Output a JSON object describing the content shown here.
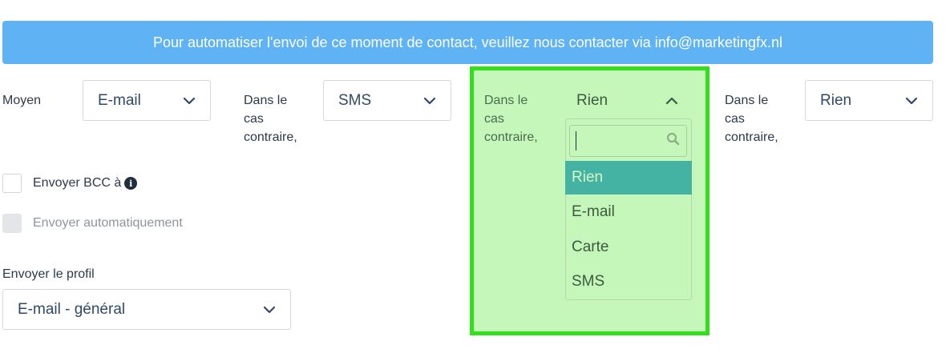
{
  "banner": {
    "text": "Pour automatiser l'envoi de ce moment de contact, veuillez nous contacter via info@marketingfx.nl"
  },
  "moyen": {
    "label": "Moyen",
    "value": "E-mail"
  },
  "fallback1": {
    "label_lines": [
      "Dans le",
      "cas",
      "contraire,"
    ],
    "value": "SMS"
  },
  "fallback2": {
    "label_lines": [
      "Dans le",
      "cas",
      "contraire,"
    ],
    "value": "Rien",
    "search_placeholder": "",
    "options": [
      "Rien",
      "E-mail",
      "Carte",
      "SMS"
    ],
    "selected_index": 0
  },
  "fallback3": {
    "label_lines": [
      "Dans le",
      "cas",
      "contraire,"
    ],
    "value": "Rien"
  },
  "bcc": {
    "label": "Envoyer BCC à",
    "checked": false
  },
  "auto_send": {
    "label": "Envoyer automatiquement",
    "checked": false,
    "disabled": true
  },
  "profile": {
    "label": "Envoyer le profil",
    "value": "E-mail - général"
  },
  "colors": {
    "banner": "#5fb3f4",
    "highlight_fill": "#c6f7ba",
    "highlight_border": "#2fe01b",
    "selected_option": "#45b3a3"
  },
  "icons": {
    "chevron": "chevron-down-icon",
    "chevron_open": "chevron-up-icon",
    "search": "search-icon",
    "info": "info-icon"
  }
}
